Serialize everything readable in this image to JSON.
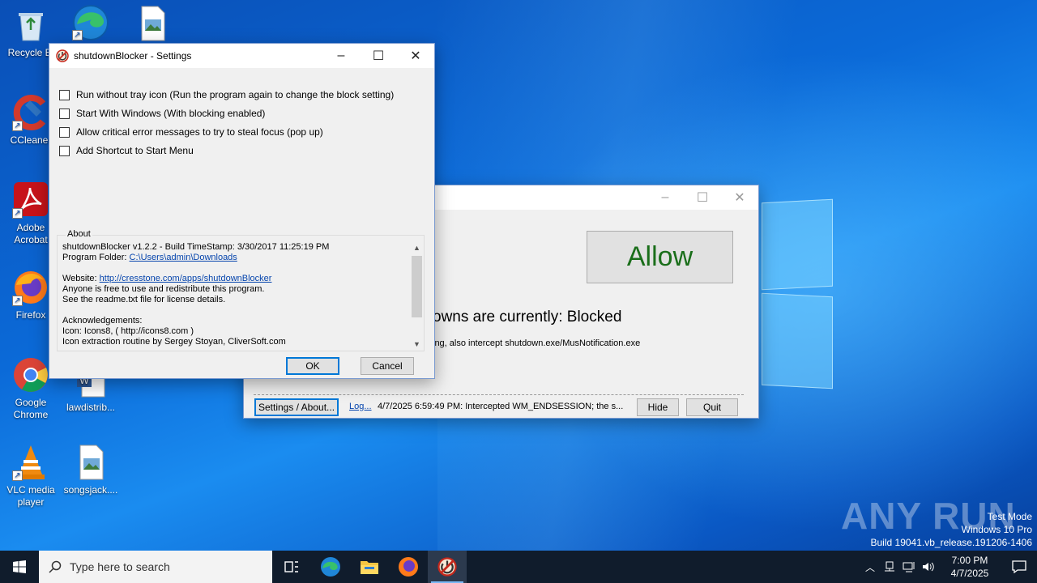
{
  "desktop": {
    "icons": [
      {
        "label": "Recycle Bi",
        "icon": "recycle-bin-icon"
      },
      {
        "label": "",
        "icon": "edge-icon"
      },
      {
        "label": "",
        "icon": "image-file-icon"
      },
      {
        "label": "CCleaner",
        "icon": "ccleaner-icon"
      },
      {
        "label": "Adobe Acrobat",
        "icon": "acrobat-icon"
      },
      {
        "label": "Firefox",
        "icon": "firefox-icon"
      },
      {
        "label": "Google Chrome",
        "icon": "chrome-icon"
      },
      {
        "label": "lawdistrib...",
        "icon": "word-doc-icon"
      },
      {
        "label": "VLC media player",
        "icon": "vlc-icon"
      },
      {
        "label": "songsjack....",
        "icon": "image-file-icon"
      }
    ]
  },
  "main_window": {
    "allow_button": "Allow",
    "status_text": "owns are currently: Blocked",
    "sub_text": "ing, also intercept shutdown.exe/MusNotification.exe",
    "settings_button": "Settings / About...",
    "log_link": "Log...",
    "log_text": "4/7/2025 6:59:49 PM: Intercepted WM_ENDSESSION; the s...",
    "hide_button": "Hide",
    "quit_button": "Quit",
    "allow_color": "#1a6e1a"
  },
  "settings_dialog": {
    "title": "shutdownBlocker - Settings",
    "options": [
      {
        "label": "Run without tray icon (Run the program again to change the block setting)",
        "checked": false
      },
      {
        "label": "Start With Windows (With blocking enabled)",
        "checked": false
      },
      {
        "label": "Allow critical error messages to try to steal focus (pop up)",
        "checked": false
      },
      {
        "label": "Add Shortcut to Start Menu",
        "checked": false
      }
    ],
    "about_label": "About",
    "about": {
      "line1": "shutdownBlocker v1.2.2   -   Build TimeStamp: 3/30/2017 11:25:19 PM",
      "folder_prefix": "Program Folder: ",
      "folder_link": "C:\\Users\\admin\\Downloads",
      "website_prefix": "Website: ",
      "website_link": "http://cresstone.com/apps/shutdownBlocker",
      "line4": "Anyone is free to use and redistribute this program.",
      "line5": "See the readme.txt file for license details.",
      "line6": "Acknowledgements:",
      "line7": "Icon: Icons8, ( http://icons8.com )",
      "line8": "Icon extraction routine by Sergey Stoyan, CliverSoft.com"
    },
    "ok_button": "OK",
    "cancel_button": "Cancel"
  },
  "watermark": {
    "brand": "ANY RUN",
    "test_mode": "Test Mode",
    "edition": "Windows 10 Pro",
    "build": "Build 19041.vb_release.191206-1406"
  },
  "taskbar": {
    "search_placeholder": "Type here to search",
    "time": "7:00 PM",
    "date": "4/7/2025"
  }
}
